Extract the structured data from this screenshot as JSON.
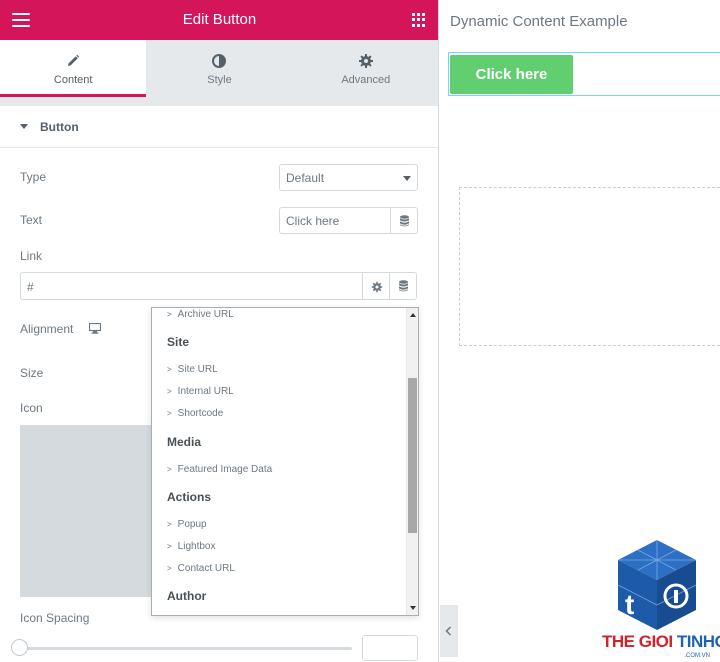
{
  "panel": {
    "header_title": "Edit Button",
    "tabs": [
      {
        "label": "Content",
        "icon": "pencil-icon",
        "active": true
      },
      {
        "label": "Style",
        "icon": "half-circle-icon",
        "active": false
      },
      {
        "label": "Advanced",
        "icon": "gear-icon",
        "active": false
      }
    ],
    "section_title": "Button",
    "controls": {
      "type_label": "Type",
      "type_value": "Default",
      "text_label": "Text",
      "text_value": "Click here",
      "link_label": "Link",
      "link_value": "#",
      "alignment_label": "Alignment",
      "size_label": "Size",
      "icon_label": "Icon",
      "icon_spacing_label": "Icon Spacing"
    }
  },
  "dropdown": {
    "items": [
      {
        "kind": "item",
        "label": "Archive URL"
      },
      {
        "kind": "group",
        "label": "Site"
      },
      {
        "kind": "item",
        "label": "Site URL"
      },
      {
        "kind": "item",
        "label": "Internal URL"
      },
      {
        "kind": "item",
        "label": "Shortcode"
      },
      {
        "kind": "group",
        "label": "Media"
      },
      {
        "kind": "item",
        "label": "Featured Image Data"
      },
      {
        "kind": "group",
        "label": "Actions"
      },
      {
        "kind": "item",
        "label": "Popup"
      },
      {
        "kind": "item",
        "label": "Lightbox"
      },
      {
        "kind": "item",
        "label": "Contact URL"
      },
      {
        "kind": "group",
        "label": "Author"
      }
    ],
    "item_prefix": ">"
  },
  "preview": {
    "title": "Dynamic Content Example",
    "button_label": "Click here"
  },
  "watermark": {
    "text_a": "THE GIOI",
    "text_b": "TINHOC",
    "sub": ".COM.VN"
  },
  "colors": {
    "accent": "#d5155a",
    "button_green": "#61ce70",
    "selection_blue": "#71d7f7"
  }
}
